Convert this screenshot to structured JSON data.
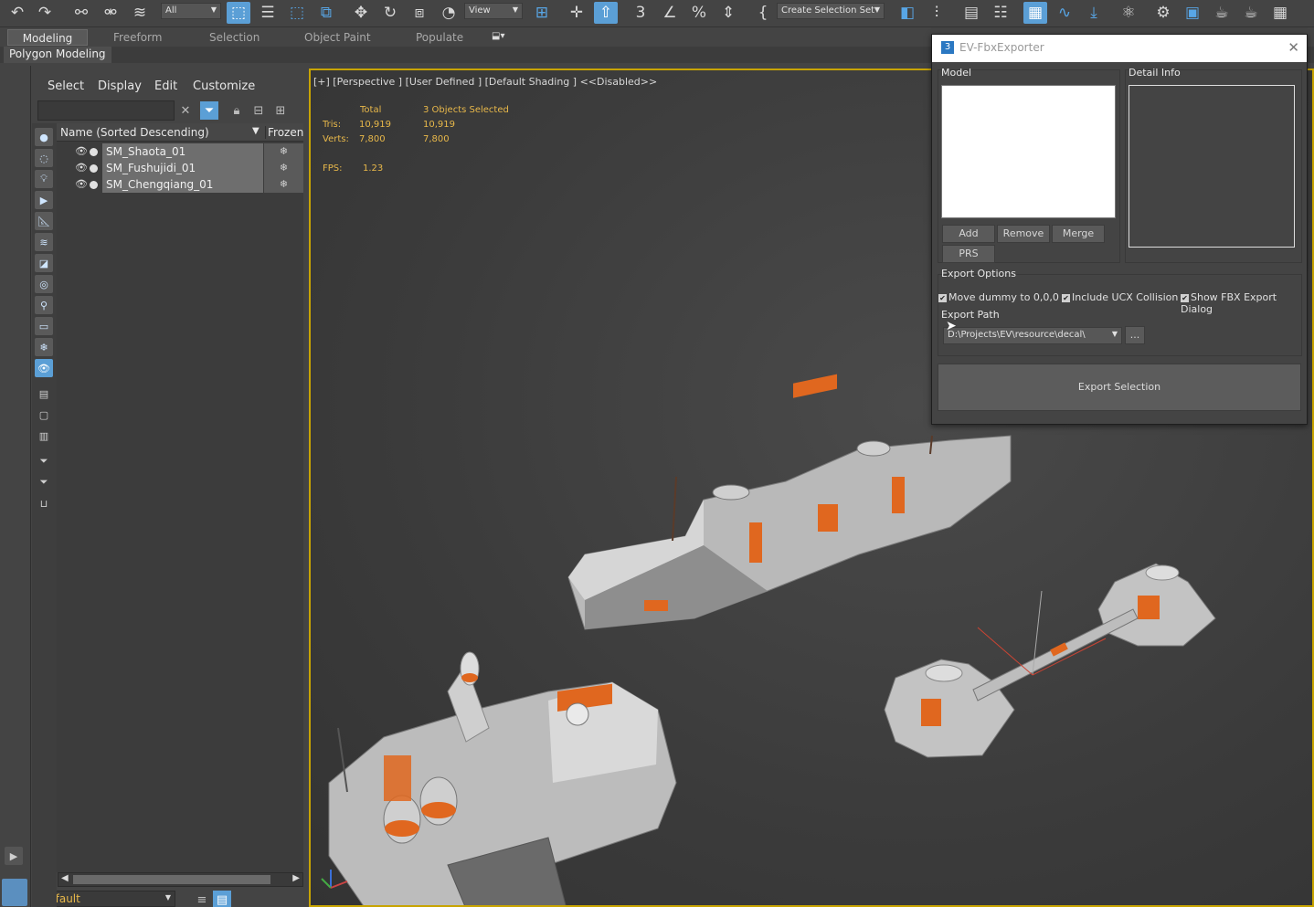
{
  "toolbar": {
    "filter_select": "All",
    "view_select": "View",
    "selection_set_select": "Create Selection Set"
  },
  "ribbon": {
    "tabs": [
      "Modeling",
      "Freeform",
      "Selection",
      "Object Paint",
      "Populate"
    ],
    "subtab": "Polygon Modeling"
  },
  "explorer": {
    "menu": [
      "Select",
      "Display",
      "Edit",
      "Customize"
    ],
    "col_name": "Name (Sorted Descending)",
    "col_frozen": "Frozen",
    "rows": [
      "SM_Shaota_01",
      "SM_Fushujidi_01",
      "SM_Chengqiang_01"
    ],
    "layer": "Default"
  },
  "viewport": {
    "label": "[+] [Perspective ] [User Defined ] [Default Shading ]  <<Disabled>>",
    "stats": {
      "total_header": "Total",
      "selected_header": "3 Objects Selected",
      "tris_label": "Tris:",
      "tris_total": "10,919",
      "tris_selected": "10,919",
      "verts_label": "Verts:",
      "verts_total": "7,800",
      "verts_selected": "7,800",
      "fps_label": "FPS:",
      "fps_value": "1.23"
    }
  },
  "dialog": {
    "title": "EV-FbxExporter",
    "model_label": "Model",
    "detail_label": "Detail Info",
    "buttons": {
      "add": "Add",
      "remove": "Remove",
      "merge": "Merge",
      "prs": "PRS"
    },
    "export_options_label": "Export Options",
    "options": [
      {
        "label": "Move dummy to 0,0,0",
        "checked": true
      },
      {
        "label": "Include UCX Collision",
        "checked": true
      },
      {
        "label": "Show FBX Export Dialog",
        "checked": true
      }
    ],
    "export_path_label": "Export Path",
    "export_path_value": "D:\\Projects\\EV\\resource\\decal\\",
    "browse_label": "...",
    "export_button": "Export Selection"
  },
  "colors": {
    "accent": "#5b9fd6",
    "viewport_border": "#c8a400",
    "stats_text": "#e8b84a",
    "model_orange": "#e0671f"
  }
}
